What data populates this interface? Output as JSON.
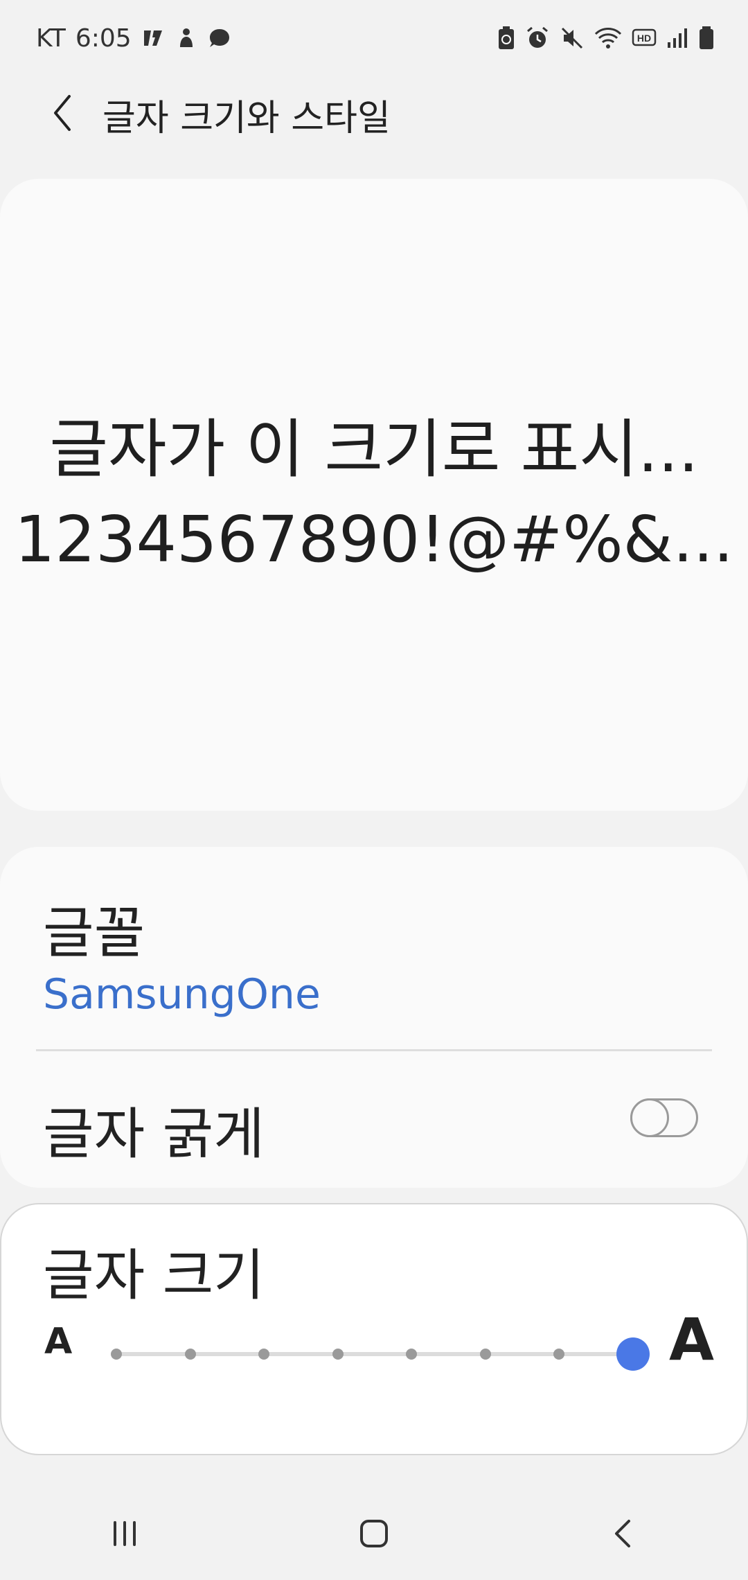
{
  "status_bar": {
    "carrier": "KT",
    "time": "6:05",
    "left_icons": [
      "vibe-icon",
      "notification-person-icon",
      "chat-bubble-icon"
    ],
    "right_icons": [
      "battery-saver-icon",
      "alarm-icon",
      "mute-icon",
      "wifi-icon",
      "hd-icon",
      "signal-icon",
      "battery-icon"
    ]
  },
  "app_bar": {
    "title": "글자 크기와 스타일",
    "back_icon": "chevron-left-icon"
  },
  "preview": {
    "line1": "글자가 이 크기로 표시...",
    "line2": "1234567890!@#%&..."
  },
  "settings": {
    "font_label": "글꼴",
    "font_value": "SamsungOne",
    "bold_label": "글자 굵게",
    "bold_enabled": false
  },
  "size": {
    "label": "글자 크기",
    "small_marker": "A",
    "large_marker": "A",
    "steps": 8,
    "current_step": 8
  },
  "colors": {
    "accent": "#4a78e6",
    "link": "#3a6fcb",
    "background": "#f2f2f2",
    "card": "#fafafa"
  },
  "nav_bar": {
    "icons": [
      "recent-apps-icon",
      "home-icon",
      "back-icon"
    ]
  }
}
